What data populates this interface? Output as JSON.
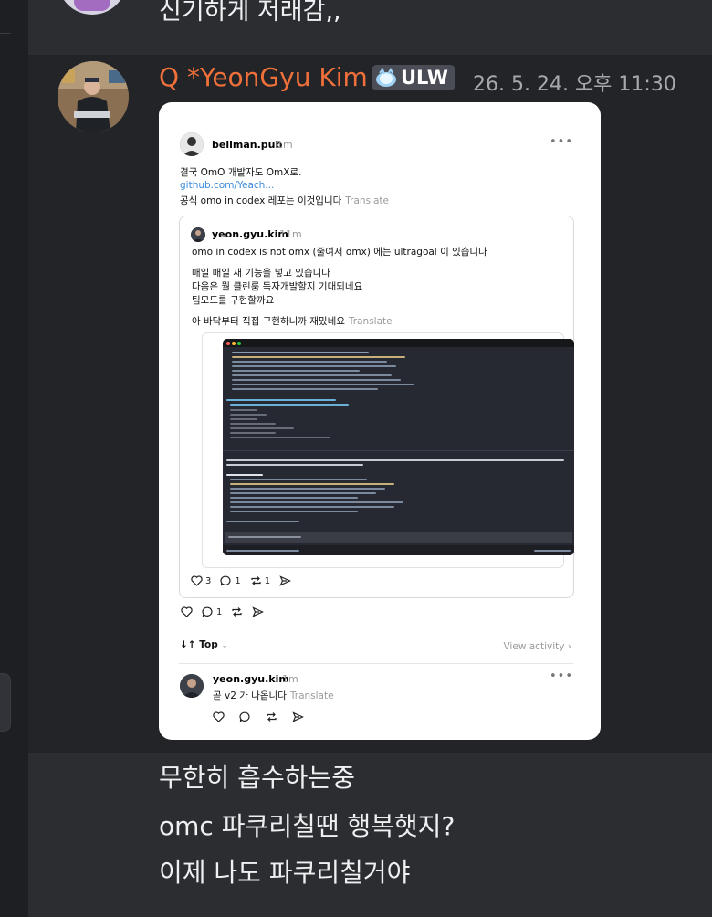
{
  "previous_message": {
    "text": "신기하게 저래감,,"
  },
  "message": {
    "author": "Q *YeonGyu Kim",
    "badge_label": "ULW",
    "timestamp": "26. 5. 24. 오후 11:30",
    "author_color": "#f0703a",
    "lines": [
      "무한히 흡수하는중",
      "omc 파쿠리칠땐 행복햇지?",
      "이제 나도 파쿠리칠거야"
    ]
  },
  "embed": {
    "post": {
      "username": "bellman.pub",
      "time": "1m",
      "text_line1": "결국 OmO 개발자도 OmX로.",
      "link": "github.com/Yeach...",
      "text_line3": "공식 omo in codex 레포는 이것입니다",
      "translate": "Translate"
    },
    "quoted": {
      "username": "yeon.gyu.kim",
      "time": "11m",
      "line1": "omo in codex is not omx (줄여서 omx) 에는 ultragoal 이 있습니다",
      "line2": "매일 매일 새 기능을 넣고 있습니다",
      "line3": "다음은 뭘 클린룸 독자개발할지 기대되네요",
      "line4": "팀모드를 구현할까요",
      "line5": "아 바닥부터 직접 구현하니까 재밌네요",
      "translate": "Translate",
      "likes": "3",
      "replies": "1",
      "reposts": "1"
    },
    "post_actions": {
      "replies": "1"
    },
    "sort": {
      "label": "Top",
      "view_activity": "View activity"
    },
    "reply": {
      "username": "yeon.gyu.kim",
      "time": "1m",
      "text": "곧 v2 가 나옵니다",
      "translate": "Translate"
    },
    "icons": [
      "heart-icon",
      "comment-icon",
      "repost-icon",
      "share-icon",
      "more-icon",
      "chevron-down-icon",
      "chevron-right-icon",
      "sort-icon"
    ]
  }
}
